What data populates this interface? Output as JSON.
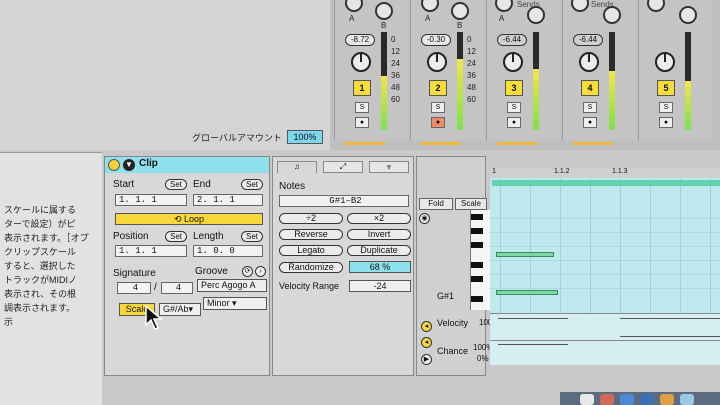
{
  "mixer": {
    "global_amount_label": "グローバルアマウント",
    "global_amount_value": "100%",
    "sends_label": "Sends",
    "tracks": [
      {
        "number": "1",
        "volume": "-8.72",
        "meter_level": 0.55,
        "arm_red": false
      },
      {
        "number": "2",
        "volume": "-0.30",
        "meter_level": 0.72,
        "arm_red": true
      },
      {
        "number": "3",
        "volume": "-6.44",
        "meter_level": 0.62,
        "arm_red": false
      },
      {
        "number": "4",
        "volume": "-6.44",
        "meter_level": 0.6,
        "arm_red": false
      },
      {
        "number": "5",
        "volume": "",
        "meter_level": 0.5,
        "arm_red": false
      }
    ],
    "db_scale": [
      "0",
      "12",
      "24",
      "36",
      "48",
      "60"
    ],
    "knob_a": "A",
    "knob_b": "B",
    "solo_label": "S"
  },
  "jp_text": [
    "スケールに属する",
    "ターで設定）がピ",
    "表示されます。［オプ",
    "クリップスケール",
    "すると、選択した",
    "トラックがMIDIノ",
    "表示され、その根",
    "調表示されます。",
    "示"
  ],
  "clip": {
    "title": "Clip",
    "start_label": "Start",
    "end_label": "End",
    "set_label": "Set",
    "start_value": "1.   1.   1",
    "end_value": "2.   1.   1",
    "loop_label": "Loop",
    "position_label": "Position",
    "length_label": "Length",
    "position_value": "1.   1.   1",
    "length_value": "1.   0.   0",
    "signature_label": "Signature",
    "groove_label": "Groove",
    "sig_num": "4",
    "sig_den": "4",
    "slash": "/",
    "groove_value": "Perc Agogo A",
    "scale_label": "Scale",
    "root_value": "G#/Ab",
    "mode_value": "Minor"
  },
  "notes": {
    "title": "Notes",
    "range": "G#1–B2",
    "div2": "÷2",
    "mul2": "×2",
    "reverse": "Reverse",
    "invert": "Invert",
    "legato": "Legato",
    "duplicate": "Duplicate",
    "randomize": "Randomize",
    "randomize_value": "68 %",
    "velocity_range_label": "Velocity Range",
    "velocity_range_value": "-24"
  },
  "roll": {
    "fold_label": "Fold",
    "scale_label": "Scale",
    "note_label": "G#1",
    "ruler_marks": [
      "1",
      "1.1.2",
      "1.1.3"
    ],
    "velocity_label": "Velocity",
    "velocity_value": "100",
    "chance_label": "Chance",
    "chance_top": "100%",
    "chance_bottom": "0%"
  }
}
